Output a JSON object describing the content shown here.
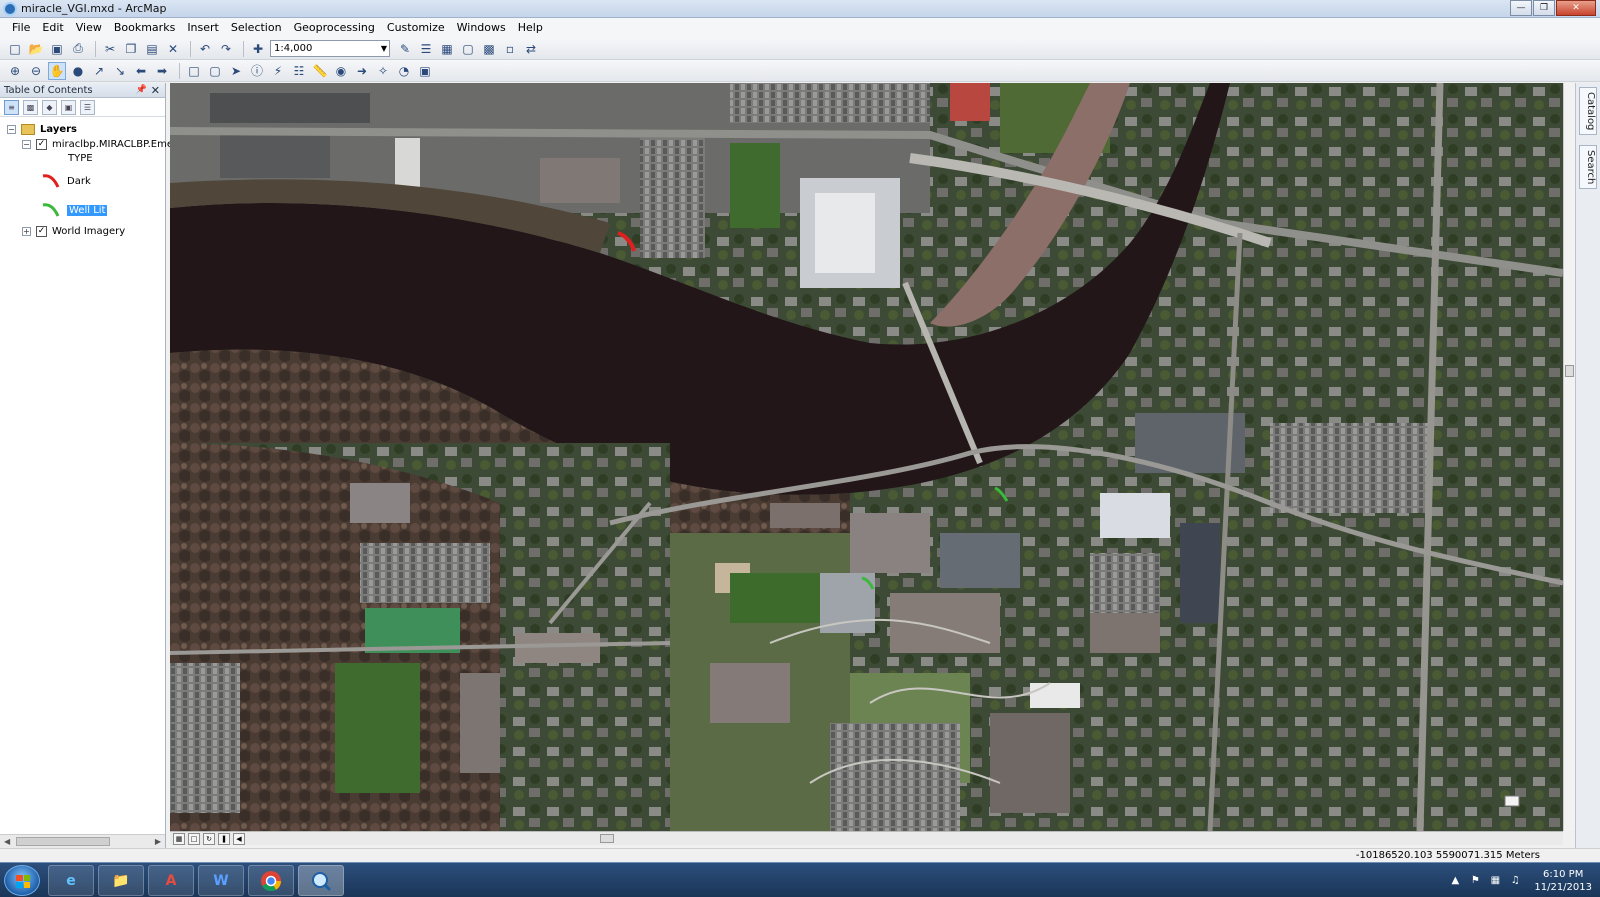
{
  "window": {
    "title": "miracle_VGI.mxd - ArcMap"
  },
  "menu": [
    "File",
    "Edit",
    "View",
    "Bookmarks",
    "Insert",
    "Selection",
    "Geoprocessing",
    "Customize",
    "Windows",
    "Help"
  ],
  "toolbar": {
    "scale_value": "1:4,000"
  },
  "toc": {
    "title": "Table Of Contents",
    "root_label": "Layers",
    "layer1_name": "miraclbp.MIRACLBP.Eme",
    "field_label": "TYPE",
    "legend": [
      {
        "label": "Dark",
        "color": "#e02020"
      },
      {
        "label": "Well Lit",
        "color": "#3cb83c"
      }
    ],
    "layer2_name": "World Imagery"
  },
  "dock": {
    "tabs": [
      "Catalog",
      "Search"
    ]
  },
  "status": {
    "coordinates": "-10186520.103  5590071.315 Meters"
  },
  "taskbar": {
    "time": "6:10 PM",
    "date": "11/21/2013"
  },
  "colors": {
    "river": "#1e1518",
    "selection": "#3399ff",
    "dark_segment": "#e02020",
    "lit_segment": "#3cb83c"
  }
}
